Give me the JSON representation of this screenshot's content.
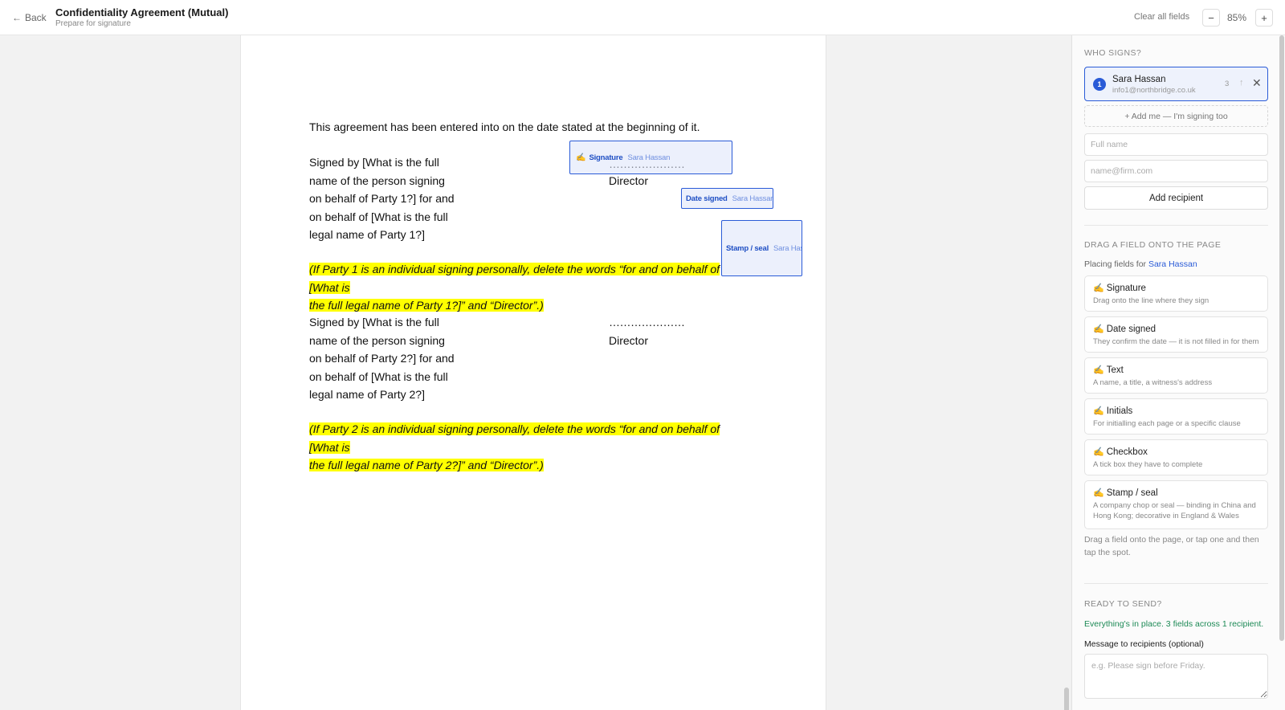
{
  "header": {
    "back_label": "Back",
    "back_icon": "arrow-left-icon",
    "title": "Confidentiality Agreement (Mutual)",
    "subtitle": "Prepare for signature",
    "clear_label": "Clear all fields",
    "zoom_out": "−",
    "zoom_in": "+",
    "zoom_level": "85%"
  },
  "document": {
    "intro": "This agreement has been entered into on the date stated at the beginning of it.",
    "block1": [
      "Signed by [What is the full",
      "name of the person signing",
      "on behalf of Party 1?] for and",
      "on behalf of [What is the full",
      "legal name of Party 1?]"
    ],
    "block2": [
      "Signed by [What is the full",
      "name of the person signing",
      "on behalf of Party 2?] for and",
      "on behalf of [What is the full",
      "legal name of Party 2?]"
    ],
    "dots": "…………………",
    "director": "Director",
    "note1_lines": [
      "(If Party 1 is an individual signing personally, delete the words “for and on behalf of [What is",
      "the full legal name of Party 1?]” and “Director”.)"
    ],
    "note2_lines": [
      "(If Party 2 is an individual signing personally, delete the words “for and on behalf of [What is",
      "the full legal name of Party 2?]” and “Director”.)"
    ],
    "highlight_color": "#ffff00"
  },
  "placed_fields": {
    "signature": {
      "type": "Signature",
      "who": "Sara Hassan"
    },
    "date": {
      "type": "Date signed",
      "who": "Sara Hassan"
    },
    "stamp": {
      "type": "Stamp / seal",
      "who": "Sara Hass"
    }
  },
  "sidebar": {
    "who_signs_title": "WHO SIGNS?",
    "recipient": {
      "number": "1",
      "name": "Sara Hassan",
      "email": "info1@northbridge.co.uk",
      "field_count": "3"
    },
    "add_me_label": "+ Add me — I'm signing too",
    "name_placeholder": "Full name",
    "email_placeholder": "name@firm.com",
    "add_recipient_label": "Add recipient",
    "drag_title": "DRAG A FIELD ONTO THE PAGE",
    "placing_prefix": "Placing fields for",
    "placing_name": "Sara Hassan",
    "field_types": [
      {
        "title": "Signature",
        "desc": "Drag onto the line where they sign"
      },
      {
        "title": "Date signed",
        "desc": "They confirm the date — it is not filled in for them"
      },
      {
        "title": "Text",
        "desc": "A name, a title, a witness's address"
      },
      {
        "title": "Initials",
        "desc": "For initialling each page or a specific clause"
      },
      {
        "title": "Checkbox",
        "desc": "A tick box they have to complete"
      },
      {
        "title": "Stamp / seal",
        "desc": "A company chop or seal — binding in China and Hong Kong; decorative in England & Wales"
      }
    ],
    "hint": "Drag a field onto the page, or tap one and then tap the spot.",
    "ready_title": "READY TO SEND?",
    "ready_status": "Everything's in place. 3 fields across 1 recipient.",
    "message_label": "Message to recipients (optional)",
    "message_placeholder": "e.g. Please sign before Friday."
  },
  "colors": {
    "accent": "#2a5bd7",
    "success": "#1d8a56"
  }
}
